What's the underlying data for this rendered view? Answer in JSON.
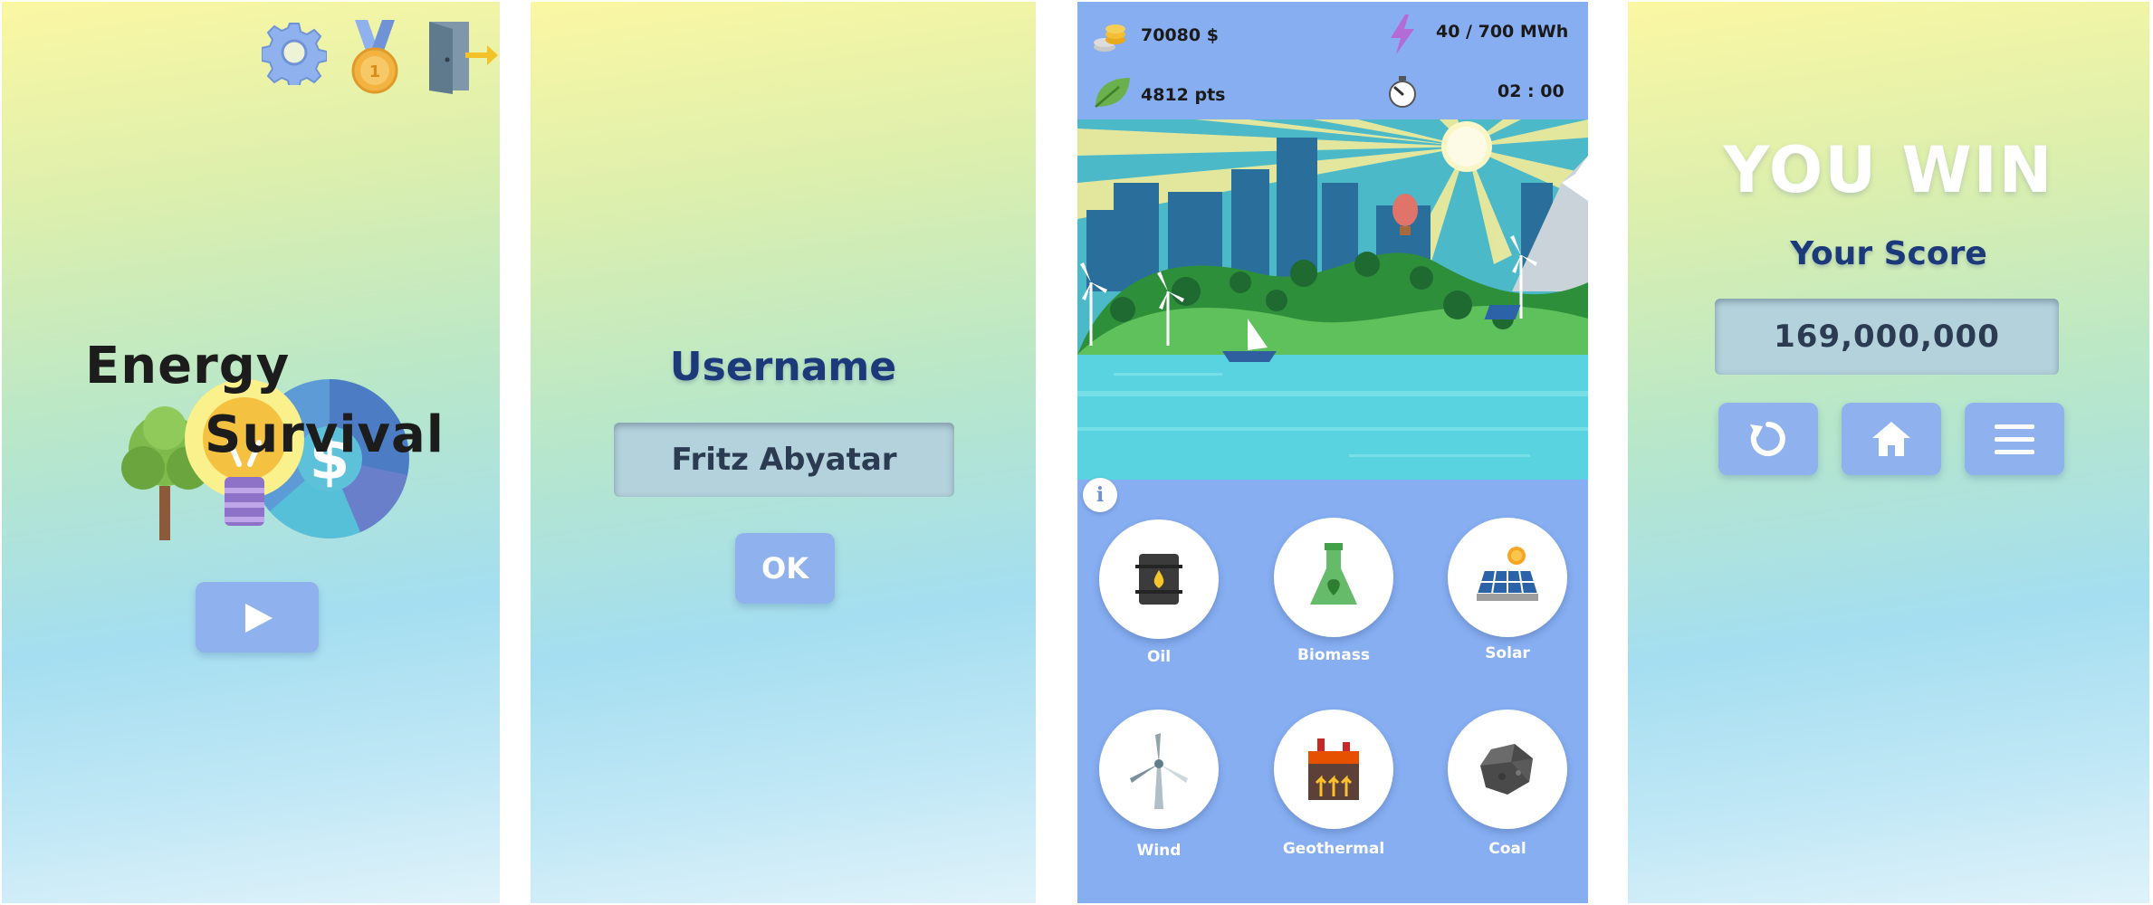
{
  "start_screen": {
    "title_line1": "Energy",
    "title_line2": "Survival",
    "icons": [
      "gear-icon",
      "medal-icon",
      "exit-door-icon",
      "play-icon"
    ]
  },
  "login_screen": {
    "username_label": "Username",
    "username_value": "Fritz Abyatar",
    "ok_label": "OK"
  },
  "game_screen": {
    "hud": {
      "money": "70080 $",
      "energy": "40 / 700 MWh",
      "points": "4812 pts",
      "timer": "02 : 00"
    },
    "info_label": "i",
    "energy_sources": [
      {
        "label": "Oil",
        "icon": "oil-barrel-icon"
      },
      {
        "label": "Biomass",
        "icon": "biomass-flask-icon"
      },
      {
        "label": "Solar",
        "icon": "solar-panel-icon"
      },
      {
        "label": "Wind",
        "icon": "wind-turbine-icon"
      },
      {
        "label": "Geothermal",
        "icon": "geothermal-plant-icon"
      },
      {
        "label": "Coal",
        "icon": "coal-icon"
      }
    ]
  },
  "result_screen": {
    "headline": "YOU WIN",
    "score_label": "Your Score",
    "score_value": "169,000,000",
    "buttons": [
      "restart-icon",
      "home-icon",
      "menu-icon"
    ]
  },
  "colors": {
    "button_blue": "#8fb1ee",
    "game_bg": "#86aef1",
    "heading_navy": "#1c3a7a"
  }
}
